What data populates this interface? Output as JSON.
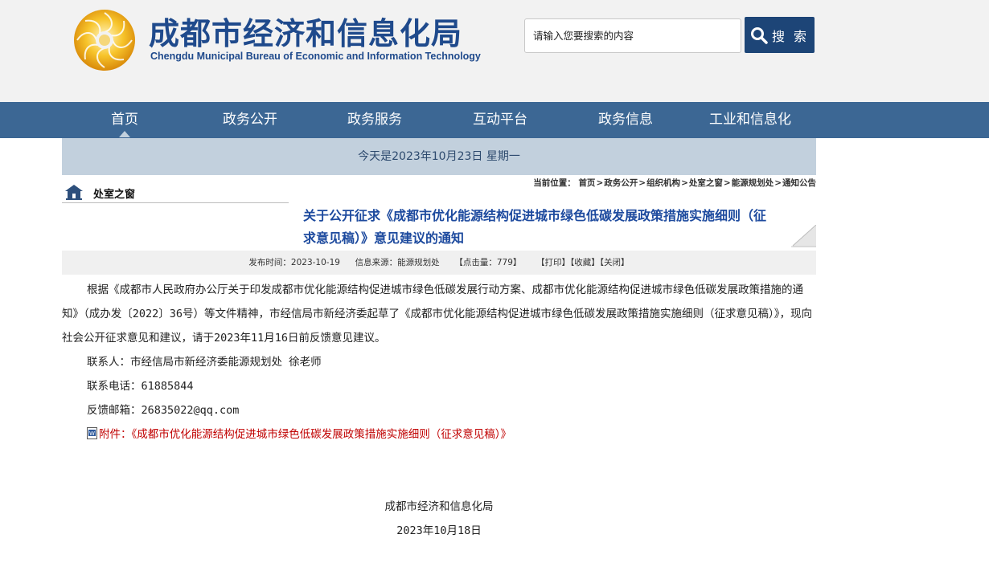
{
  "header": {
    "title_cn": "成都市经济和信息化局",
    "title_en": "Chengdu Municipal Bureau of Economic and Information Technology",
    "logo_icon": "sun-logo-icon",
    "brand_color": "#1f4a8c"
  },
  "search": {
    "placeholder": "请输入您要搜索的内容",
    "button_label": "搜 索",
    "button_icon": "search-icon"
  },
  "nav": {
    "items": [
      {
        "label": "首页"
      },
      {
        "label": "政务公开"
      },
      {
        "label": "政务服务"
      },
      {
        "label": "互动平台"
      },
      {
        "label": "政务信息"
      },
      {
        "label": "工业和信息化"
      }
    ],
    "active": "首页",
    "color": "#3c6794"
  },
  "date_bar": {
    "text": "今天是2023年10月23日 星期一"
  },
  "breadcrumb": {
    "prefix": "当前位置：",
    "items": [
      "首页",
      "政务公开",
      "组织机构",
      "处室之窗",
      "能源规划处",
      "通知公告"
    ]
  },
  "sidebar": {
    "title": "处室之窗",
    "icon": "home-icon"
  },
  "article": {
    "title": "关于公开征求《成都市优化能源结构促进城市绿色低碳发展政策措施实施细则（征求意见稿）》意见建议的通知",
    "meta": {
      "publish_time": "发布时间：2023-10-19",
      "source": "信息来源：能源规划处",
      "clicks": "【点击量：779】",
      "print": "【打印】",
      "favorite": "【收藏】",
      "close": "【关闭】"
    },
    "paragraphs": [
      "根据《成都市人民政府办公厅关于印发成都市优化能源结构促进城市绿色低碳发展行动方案、成都市优化能源结构促进城市绿色低碳发展政策措施的通知》（成办发〔2022〕36号）等文件精神，市经信局市新经济委起草了《成都市优化能源结构促进城市绿色低碳发展政策措施实施细则（征求意见稿）》，现向社会公开征求意见和建议，请于2023年11月16日前反馈意见建议。",
      "联系人：市经信局市新经济委能源规划处 徐老师",
      "联系电话：61885844",
      "反馈邮箱：26835022@qq.com"
    ],
    "attachment": "附件：《成都市优化能源结构促进城市绿色低碳发展政策措施实施细则（征求意见稿）》",
    "attachment_icon": "doc-icon",
    "attachment_color": "#c00000",
    "signature_org": "成都市经济和信息化局",
    "signature_date": "2023年10月18日"
  }
}
